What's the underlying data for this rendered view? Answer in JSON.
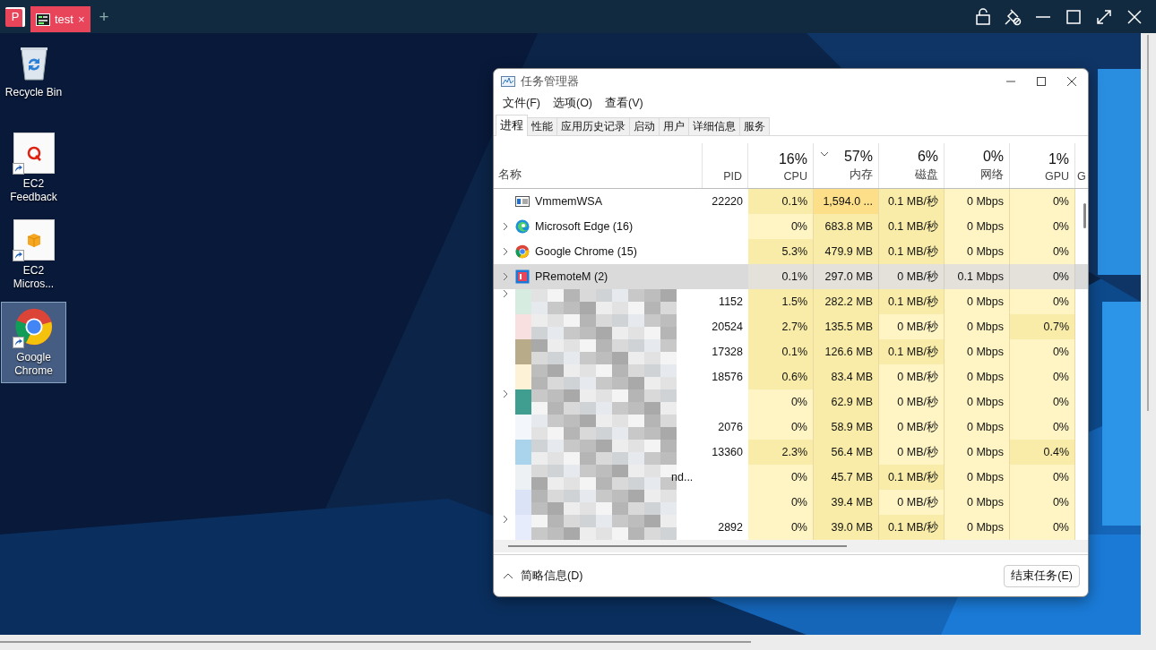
{
  "remote_bar": {
    "logo": "P",
    "tabs": [
      {
        "label": "test",
        "close": "×",
        "selected": true
      }
    ],
    "new_tab": "+"
  },
  "desktop_icons": [
    {
      "label": "Recycle Bin",
      "kind": "recycle",
      "shortcut": false,
      "selected": false
    },
    {
      "label": "EC2 Feedback",
      "kind": "feedback",
      "shortcut": true,
      "selected": false
    },
    {
      "label": "EC2 Micros...",
      "kind": "box",
      "shortcut": true,
      "selected": false
    },
    {
      "label": "Google Chrome",
      "kind": "chrome",
      "shortcut": true,
      "selected": true
    }
  ],
  "task_manager": {
    "title": "任务管理器",
    "menu": [
      "文件(F)",
      "选项(O)",
      "查看(V)"
    ],
    "tabs": [
      {
        "label": "进程",
        "selected": true
      },
      {
        "label": "性能",
        "selected": false
      },
      {
        "label": "应用历史记录",
        "selected": false
      },
      {
        "label": "启动",
        "selected": false
      },
      {
        "label": "用户",
        "selected": false
      },
      {
        "label": "详细信息",
        "selected": false
      },
      {
        "label": "服务",
        "selected": false
      }
    ],
    "name_column": "名称",
    "pid_column": "PID",
    "columns": [
      {
        "label": "CPU",
        "usage": "16%",
        "sorted": false
      },
      {
        "label": "内存",
        "usage": "57%",
        "sorted": true
      },
      {
        "label": "磁盘",
        "usage": "6%",
        "sorted": false
      },
      {
        "label": "网络",
        "usage": "0%",
        "sorted": false
      },
      {
        "label": "GPU",
        "usage": "1%",
        "sorted": false
      }
    ],
    "cut_column": "G",
    "rows": [
      {
        "kind": "window",
        "name": "VmmemWSA",
        "pid": "22220",
        "expandable": false,
        "selected": false,
        "cells": [
          {
            "text": "0.1%",
            "color": "#f9eca8"
          },
          {
            "text": "1,594.0 ...",
            "color": "#fedf89"
          },
          {
            "text": "0.1 MB/秒",
            "color": "#f9eca8"
          },
          {
            "text": "0 Mbps",
            "color": "#fff4c4"
          },
          {
            "text": "0%",
            "color": "#fff4c4"
          }
        ]
      },
      {
        "kind": "edge",
        "name": "Microsoft Edge (16)",
        "expandable": true,
        "selected": false,
        "cells": [
          {
            "text": "0%",
            "color": "#fff4c4"
          },
          {
            "text": "683.8 MB",
            "color": "#f9eca8"
          },
          {
            "text": "0.1 MB/秒",
            "color": "#f9eca8"
          },
          {
            "text": "0 Mbps",
            "color": "#fff4c4"
          },
          {
            "text": "0%",
            "color": "#fff4c4"
          }
        ]
      },
      {
        "kind": "chrome",
        "name": "Google Chrome (15)",
        "expandable": true,
        "selected": false,
        "cells": [
          {
            "text": "5.3%",
            "color": "#f9eca8"
          },
          {
            "text": "479.9 MB",
            "color": "#f9eca8"
          },
          {
            "text": "0.1 MB/秒",
            "color": "#f9eca8"
          },
          {
            "text": "0 Mbps",
            "color": "#fff4c4"
          },
          {
            "text": "0%",
            "color": "#fff4c4"
          }
        ]
      },
      {
        "kind": "premote",
        "name": "PRemoteM (2)",
        "expandable": true,
        "selected": true,
        "cells": [
          {
            "text": "0.1%"
          },
          {
            "text": "297.0 MB"
          },
          {
            "text": "0 MB/秒"
          },
          {
            "text": "0.1 Mbps"
          },
          {
            "text": "0%"
          }
        ]
      },
      {
        "kind": "redacted",
        "pid": "1152",
        "expandable": true,
        "selected": false,
        "cells": [
          {
            "text": "1.5%",
            "color": "#f9eca8"
          },
          {
            "text": "282.2 MB",
            "color": "#f9eca8"
          },
          {
            "text": "0.1 MB/秒",
            "color": "#f9eca8"
          },
          {
            "text": "0 Mbps",
            "color": "#fff4c4"
          },
          {
            "text": "0%",
            "color": "#fff4c4"
          }
        ]
      },
      {
        "kind": "redacted",
        "pid": "20524",
        "expandable": false,
        "selected": false,
        "cells": [
          {
            "text": "2.7%",
            "color": "#f9eca8"
          },
          {
            "text": "135.5 MB",
            "color": "#f9eca8"
          },
          {
            "text": "0 MB/秒",
            "color": "#fff4c4"
          },
          {
            "text": "0 Mbps",
            "color": "#fff4c4"
          },
          {
            "text": "0.7%",
            "color": "#f9eca8"
          }
        ]
      },
      {
        "kind": "redacted",
        "pid": "17328",
        "expandable": false,
        "selected": false,
        "cells": [
          {
            "text": "0.1%",
            "color": "#f9eca8"
          },
          {
            "text": "126.6 MB",
            "color": "#f9eca8"
          },
          {
            "text": "0.1 MB/秒",
            "color": "#f9eca8"
          },
          {
            "text": "0 Mbps",
            "color": "#fff4c4"
          },
          {
            "text": "0%",
            "color": "#fff4c4"
          }
        ]
      },
      {
        "kind": "redacted",
        "pid": "18576",
        "expandable": false,
        "selected": false,
        "cells": [
          {
            "text": "0.6%",
            "color": "#f9eca8"
          },
          {
            "text": "83.4 MB",
            "color": "#f9eca8"
          },
          {
            "text": "0 MB/秒",
            "color": "#fff4c4"
          },
          {
            "text": "0 Mbps",
            "color": "#fff4c4"
          },
          {
            "text": "0%",
            "color": "#fff4c4"
          }
        ]
      },
      {
        "kind": "redacted",
        "expandable": true,
        "selected": false,
        "cells": [
          {
            "text": "0%",
            "color": "#fff4c4"
          },
          {
            "text": "62.9 MB",
            "color": "#f9eca8"
          },
          {
            "text": "0 MB/秒",
            "color": "#fff4c4"
          },
          {
            "text": "0 Mbps",
            "color": "#fff4c4"
          },
          {
            "text": "0%",
            "color": "#fff4c4"
          }
        ]
      },
      {
        "kind": "redacted",
        "pid": "2076",
        "expandable": false,
        "selected": false,
        "cells": [
          {
            "text": "0%",
            "color": "#fff4c4"
          },
          {
            "text": "58.9 MB",
            "color": "#f9eca8"
          },
          {
            "text": "0 MB/秒",
            "color": "#fff4c4"
          },
          {
            "text": "0 Mbps",
            "color": "#fff4c4"
          },
          {
            "text": "0%",
            "color": "#fff4c4"
          }
        ]
      },
      {
        "kind": "redacted",
        "pid": "13360",
        "expandable": false,
        "selected": false,
        "cells": [
          {
            "text": "2.3%",
            "color": "#f9eca8"
          },
          {
            "text": "56.4 MB",
            "color": "#f9eca8"
          },
          {
            "text": "0 MB/秒",
            "color": "#fff4c4"
          },
          {
            "text": "0 Mbps",
            "color": "#fff4c4"
          },
          {
            "text": "0.4%",
            "color": "#f9eca8"
          }
        ]
      },
      {
        "kind": "redacted",
        "name": "nd...",
        "expandable": false,
        "selected": false,
        "cells": [
          {
            "text": "0%",
            "color": "#fff4c4"
          },
          {
            "text": "45.7 MB",
            "color": "#f9eca8"
          },
          {
            "text": "0.1 MB/秒",
            "color": "#f9eca8"
          },
          {
            "text": "0 Mbps",
            "color": "#fff4c4"
          },
          {
            "text": "0%",
            "color": "#fff4c4"
          }
        ]
      },
      {
        "kind": "redacted",
        "expandable": false,
        "selected": false,
        "cells": [
          {
            "text": "0%",
            "color": "#fff4c4"
          },
          {
            "text": "39.4 MB",
            "color": "#f9eca8"
          },
          {
            "text": "0 MB/秒",
            "color": "#fff4c4"
          },
          {
            "text": "0 Mbps",
            "color": "#fff4c4"
          },
          {
            "text": "0%",
            "color": "#fff4c4"
          }
        ]
      },
      {
        "kind": "redacted",
        "pid": "2892",
        "expandable": true,
        "selected": false,
        "cells": [
          {
            "text": "0%",
            "color": "#fff4c4"
          },
          {
            "text": "39.0 MB",
            "color": "#f9eca8"
          },
          {
            "text": "0.1 MB/秒",
            "color": "#f9eca8"
          },
          {
            "text": "0 Mbps",
            "color": "#fff4c4"
          },
          {
            "text": "0%",
            "color": "#fff4c4"
          }
        ]
      }
    ],
    "fewer_details": "简略信息(D)",
    "end_task": "结束任务(E)"
  }
}
